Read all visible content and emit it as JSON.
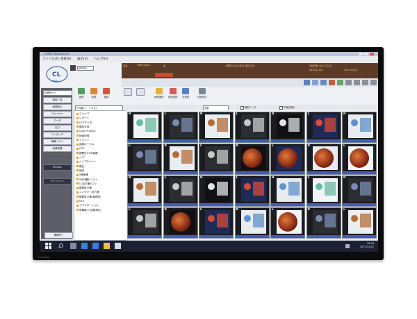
{
  "window": {
    "title": "CLINIC Dashboard"
  },
  "menu": [
    "ファイル(F)",
    "患者(K)",
    "表示(V)",
    "ヘルプ(H)"
  ],
  "patient": {
    "name": "患者",
    "id": "100000",
    "birth": "1985/12/22",
    "sex": "女"
  },
  "info": {
    "visit_label": "来院日 2021年11月8日(月)",
    "next": "次回予約 2021/11/22",
    "date1": "2021/11/05",
    "date2": "2021/12/22"
  },
  "leftbar": {
    "select": "診療所/ケア",
    "buttons": [
      "検索一覧",
      "画像取込",
      "スキャナー",
      "データ",
      "出力",
      "ワンタッチ",
      "情報リスト",
      "画像管理",
      "HM/Nav",
      "ドキュメント"
    ],
    "exit_label": "業務終了"
  },
  "toolbar": [
    "画像",
    "新規",
    "更新",
    "",
    "",
    "画像選択",
    "検査選択",
    "全選択",
    "詳細表示"
  ],
  "filter": {
    "select1": "日付順(ソートする)",
    "select2": "全部",
    "check1": "撮影データ",
    "check2": "不適合表示",
    "check3": "撮影結果"
  },
  "tree": [
    "フォーマ",
    "レポート",
    "OCTデータ",
    "眼科写真",
    "Color Fundus",
    "検査記録",
    "プリント",
    "画像ローカル",
    "OCT",
    "視野計(HFA画像)",
    "シグ",
    "シンプチャート",
    "眼圧",
    "屈折",
    "X線画像",
    "X光(撮影)リスト",
    "CL処方箋リスト",
    "眼鏡処方箋",
    "コンタクト処方箋",
    "眼鏡処方箋(管理表)",
    "NCT",
    "アプラネーション",
    "角膜厚さ(自動測定)"
  ],
  "thumb_labels": [
    "R",
    "L",
    "R",
    "L",
    "R",
    "L",
    "R",
    "L",
    "R",
    "L",
    "R",
    "L",
    "R",
    "L",
    "R",
    "L",
    "R",
    "L",
    "R",
    "L",
    "R",
    "L",
    "R",
    "L",
    "R",
    "L",
    "R",
    "L"
  ],
  "clock": {
    "time": "10:00",
    "date": "2021/12/22"
  },
  "brand": "TOSHIBA",
  "colors": {
    "accent": "#3b5fb8",
    "header_band": "#5c3b28",
    "patient_bar": "#c44a2a"
  }
}
